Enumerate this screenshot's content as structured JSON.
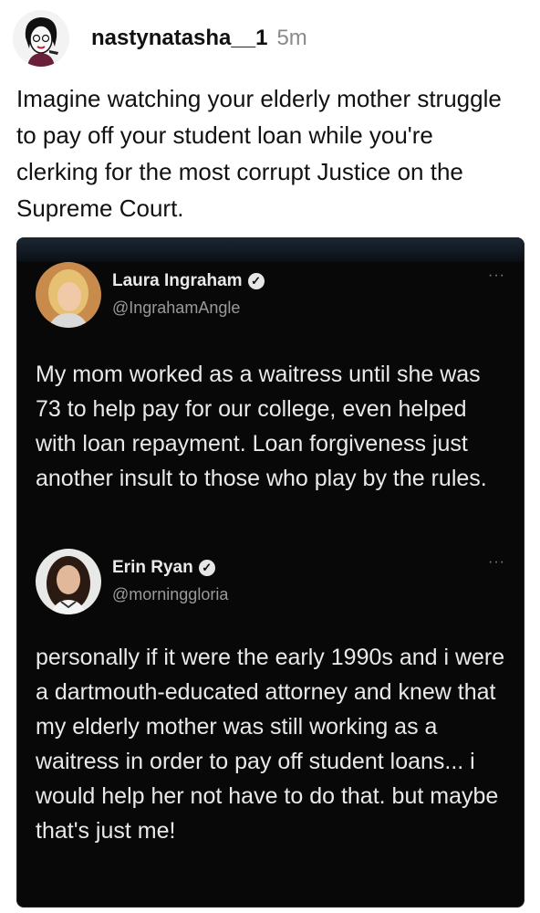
{
  "post": {
    "username": "nastynatasha__1",
    "time": "5m",
    "text": "Imagine watching your elderly mother struggle to pay off your student loan while you're clerking for the most corrupt Justice on the Supreme Court."
  },
  "tweets": [
    {
      "name": "Laura Ingraham",
      "handle": "@IngrahamAngle",
      "more": "···",
      "text": "My mom worked as a waitress until she was 73 to help pay for our college, even helped with loan repayment. Loan forgiveness just another insult to those who play by the rules."
    },
    {
      "name": "Erin Ryan",
      "handle": "@morninggloria",
      "more": "···",
      "text": "personally if it were the early 1990s and i were a dartmouth-educated attorney and knew that my elderly mother was still working as a waitress in order to pay off student loans... i would help her not have to do that. but maybe that's just me!"
    }
  ]
}
